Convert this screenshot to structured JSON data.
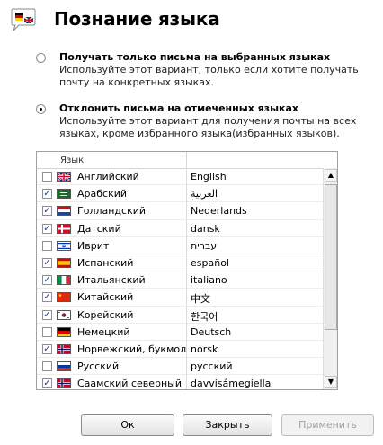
{
  "header": {
    "title": "Познание языка"
  },
  "options": [
    {
      "title": "Получать только письма на выбранных языках",
      "description": "Используйте этот вариант, только если хотите получать почту на конкретных языках.",
      "checked": false
    },
    {
      "title": "Отклонить письма на отмеченных языках",
      "description": "Используйте этот вариант для получения почты на всех языках, кроме избранного языка(избранных языков).",
      "checked": true
    }
  ],
  "language_list": {
    "header": "Язык",
    "rows": [
      {
        "name": "Английский",
        "native": "English",
        "checked": false,
        "flag": "uk-flag"
      },
      {
        "name": "Арабский",
        "native": "العربية",
        "checked": true,
        "flag": "saudi-flag"
      },
      {
        "name": "Голландский",
        "native": "Nederlands",
        "checked": true,
        "flag": "netherlands-flag"
      },
      {
        "name": "Датский",
        "native": "dansk",
        "checked": true,
        "flag": "denmark-flag"
      },
      {
        "name": "Иврит",
        "native": "עברית",
        "checked": false,
        "flag": "israel-flag"
      },
      {
        "name": "Испанский",
        "native": "español",
        "checked": true,
        "flag": "spain-flag"
      },
      {
        "name": "Итальянский",
        "native": "italiano",
        "checked": true,
        "flag": "italy-flag"
      },
      {
        "name": "Китайский",
        "native": "中文",
        "checked": true,
        "flag": "china-flag"
      },
      {
        "name": "Корейский",
        "native": "한국어",
        "checked": true,
        "flag": "korea-flag"
      },
      {
        "name": "Немецкий",
        "native": "Deutsch",
        "checked": false,
        "flag": "germany-flag"
      },
      {
        "name": "Норвежский, букмол",
        "native": "norsk",
        "checked": true,
        "flag": "norway-flag"
      },
      {
        "name": "Русский",
        "native": "русский",
        "checked": false,
        "flag": "russia-flag"
      },
      {
        "name": "Саамский северный",
        "native": "davvisámegiella",
        "checked": true,
        "flag": "norway-flag"
      }
    ]
  },
  "buttons": {
    "ok": "Ок",
    "close": "Закрыть",
    "apply": "Применить"
  },
  "icons": {
    "dialog": "language-flags-icon",
    "scroll_up": "scroll-up-arrow-icon",
    "scroll_down": "scroll-down-arrow-icon"
  }
}
